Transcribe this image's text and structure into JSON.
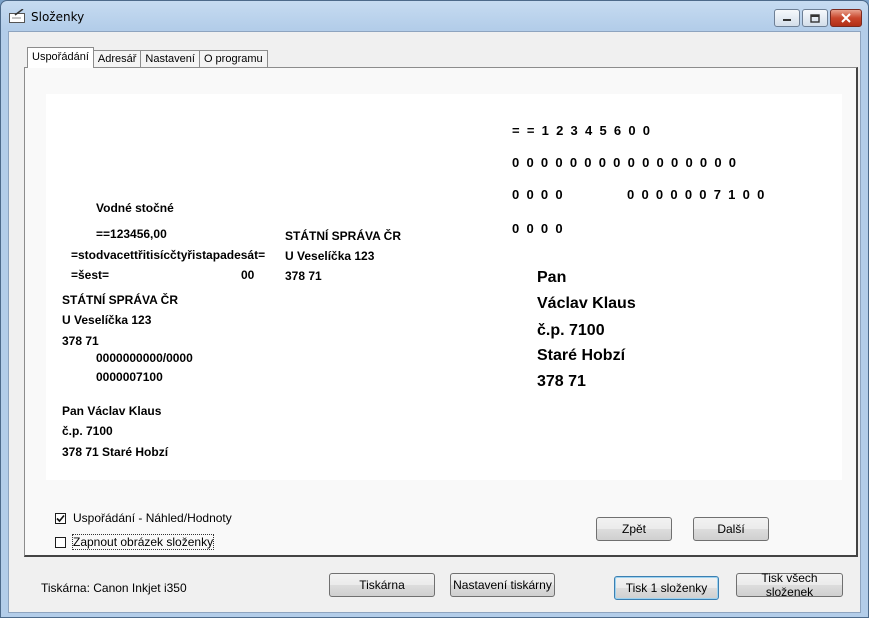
{
  "window": {
    "title": "Složenky"
  },
  "tabs": [
    {
      "label": "Uspořádání"
    },
    {
      "label": "Adresář"
    },
    {
      "label": "Nastavení"
    },
    {
      "label": "O programu"
    }
  ],
  "preview": {
    "left": {
      "service": "Vodné stočné",
      "amount": "==123456,00",
      "amount_words_1": "=stodvacettřitisícčtyřistapadesát=",
      "amount_words_2": "=šest=",
      "halere": "00",
      "recipient_name": "STÁTNÍ SPRÁVA ČR",
      "recipient_street": "U Veselíčka 123",
      "recipient_zip": "378 71",
      "account": "0000000000/0000",
      "vs": "0000007100",
      "sender_name": "Pan Václav Klaus",
      "sender_street": "č.p. 7100",
      "sender_city": "378 71 Staré Hobzí"
    },
    "middle": {
      "recipient_name": "STÁTNÍ SPRÁVA ČR",
      "recipient_street": "U Veselíčka 123",
      "recipient_zip": "378 71"
    },
    "right": {
      "digits_row1": "=  =  1  2  3  4  5  6  0  0",
      "digits_row2": "0  0  0  0  0  0  0  0  0  0  0  0  0  0  0  0",
      "digits_row3a": "0  0  0  0",
      "digits_row3b": "0  0  0  0  0  0  7  1  0  0",
      "digits_row4": "0  0  0  0",
      "addr_title": "Pan",
      "addr_name": "Václav Klaus",
      "addr_street": "č.p. 7100",
      "addr_city": "Staré Hobzí",
      "addr_zip": "378 71"
    }
  },
  "options": {
    "layout_toggle": {
      "label": "Uspořádání - Náhled/Hodnoty",
      "checked": true
    },
    "image_toggle": {
      "label": "Zapnout obrázek složenky",
      "checked": false
    }
  },
  "buttons": {
    "back": "Zpět",
    "next": "Další",
    "printer": "Tiskárna",
    "printer_settings": "Nastavení tiskárny",
    "print_one": "Tisk 1 složenky",
    "print_all": "Tisk všech složenek"
  },
  "status": {
    "printer": "Tiskárna: Canon Inkjet i350"
  },
  "colors": {
    "close_button": "#c9462c",
    "titlebar": "#c6dbf1",
    "preview_bg": "#ffffff"
  }
}
